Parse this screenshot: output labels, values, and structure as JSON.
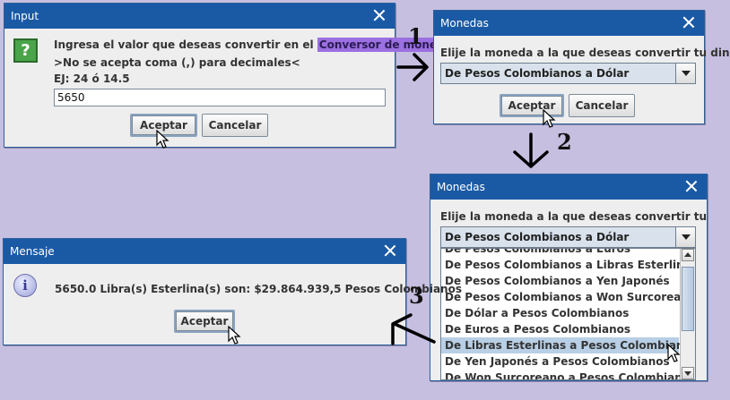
{
  "input_dialog": {
    "title": "Input",
    "line1_prefix": "Ingresa el valor que deseas convertir en el",
    "line1_highlight": "Conversor de moneda",
    "line2": ">No se acepta coma (,) para decimales<",
    "line3": "EJ: 24 ó 14.5",
    "value": "5650",
    "ok_label": "Aceptar",
    "cancel_label": "Cancelar",
    "icon": "question-icon"
  },
  "monedas_dialog_1": {
    "title": "Monedas",
    "prompt": "Elije la moneda a la que deseas convertir tu dinero",
    "selected": "De Pesos Colombianos a Dólar",
    "ok_label": "Aceptar",
    "cancel_label": "Cancelar"
  },
  "monedas_dialog_2": {
    "title": "Monedas",
    "prompt": "Elije la moneda a la que deseas convertir tu dinero",
    "selected": "De Pesos Colombianos a Dólar",
    "options": [
      "De Pesos Colombianos a Euros",
      "De Pesos Colombianos a Libras Esterlinas",
      "De Pesos Colombianos a Yen Japonés",
      "De Pesos Colombianos a Won Surcoreano",
      "De Dólar a Pesos Colombianos",
      "De Euros a Pesos Colombianos",
      "De Libras Esterlinas a Pesos Colombianos",
      "De Yen Japonés a Pesos Colombianos",
      "De Won Surcoreano a Pesos Colombianos"
    ],
    "highlighted_option": "De Libras Esterlinas a Pesos Colombianos"
  },
  "mensaje_dialog": {
    "title": "Mensaje",
    "message": "5650.0 Libra(s) Esterlina(s) son: $29.864.939,5 Pesos Colombianos",
    "ok_label": "Aceptar",
    "icon": "info-icon"
  },
  "steps": [
    "1",
    "2",
    "3"
  ],
  "colors": {
    "background": "#c6bfe0",
    "titlebar": "#1a5aa5",
    "highlight": "#9b70e0",
    "selection": "#b8cfe5"
  }
}
